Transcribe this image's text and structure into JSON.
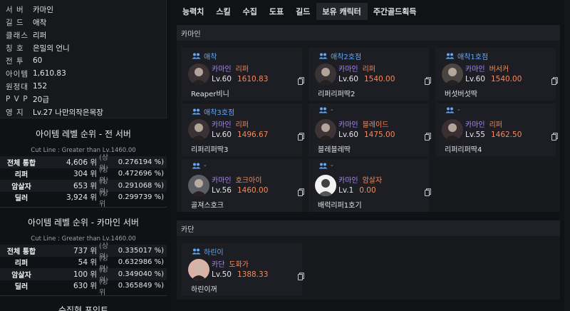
{
  "profile": {
    "rows": [
      {
        "key": "서 버",
        "value": "카마인"
      },
      {
        "key": "길 드",
        "value": "애착"
      },
      {
        "key": "클래스",
        "value": "리퍼"
      },
      {
        "key": "칭 호",
        "value": "은밀의 언니"
      },
      {
        "key": "전 투",
        "value": "60"
      },
      {
        "key": "아이템",
        "value": "1,610.83"
      },
      {
        "key": "원정대",
        "value": "152"
      },
      {
        "key": "P V P",
        "value": "20급"
      },
      {
        "key": "영 지",
        "value": "Lv.27 나만의작은목장"
      }
    ]
  },
  "rank_all": {
    "title": "아이템 레벨 순위 - 전 서버",
    "cutline": "Cut Line : Greater than Lv.1460.00",
    "rows": [
      {
        "label": "전체 통합",
        "pos": "4,606 위",
        "top": "(상위",
        "pct": "0.276194 %)"
      },
      {
        "label": "리퍼",
        "pos": "304 위",
        "top": "(상위",
        "pct": "0.472696 %)"
      },
      {
        "label": "암살자",
        "pos": "653 위",
        "top": "(상위",
        "pct": "0.291068 %)"
      },
      {
        "label": "딜러",
        "pos": "3,924 위",
        "top": "(상위",
        "pct": "0.299739 %)"
      }
    ]
  },
  "rank_server": {
    "title": "아이템 레벨 순위 - 카마인 서버",
    "cutline": "Cut Line : Greater than Lv.1460.00",
    "rows": [
      {
        "label": "전체 통합",
        "pos": "737 위",
        "top": "(상위",
        "pct": "0.335017 %)"
      },
      {
        "label": "리퍼",
        "pos": "54 위",
        "top": "(상위",
        "pct": "0.632986 %)"
      },
      {
        "label": "암살자",
        "pos": "100 위",
        "top": "(상위",
        "pct": "0.349040 %)"
      },
      {
        "label": "딜러",
        "pos": "630 위",
        "top": "(상위",
        "pct": "0.365849 %)"
      }
    ]
  },
  "next_section": "수집형 포인트",
  "tabs": [
    "능력치",
    "스킬",
    "수집",
    "도표",
    "길드",
    "보유 캐릭터",
    "주간골드획득"
  ],
  "active_tab": "보유 캐릭터",
  "groups": [
    {
      "server": "카마인",
      "cards": [
        {
          "guild": "애착",
          "server": "카마인",
          "class": "리퍼",
          "lv": "Lv.60",
          "ilvl": "1610.83",
          "name": "Reaper비니"
        },
        {
          "guild": "애착2호점",
          "server": "카마인",
          "class": "리퍼",
          "lv": "Lv.60",
          "ilvl": "1540.00",
          "name": "리퍼리퍼딱2"
        },
        {
          "guild": "애착1호점",
          "server": "카마인",
          "class": "버서커",
          "lv": "Lv.60",
          "ilvl": "1540.00",
          "name": "버섯버섯딱"
        },
        {
          "guild": "애착3호점",
          "server": "카마인",
          "class": "리퍼",
          "lv": "Lv.60",
          "ilvl": "1496.67",
          "name": "리퍼리퍼딱3"
        },
        {
          "guild": "-",
          "server": "카마인",
          "class": "블레이드",
          "lv": "Lv.60",
          "ilvl": "1475.00",
          "name": "블레블레딱"
        },
        {
          "guild": "-",
          "server": "카마인",
          "class": "리퍼",
          "lv": "Lv.55",
          "ilvl": "1462.50",
          "name": "리퍼리퍼딱4"
        },
        {
          "guild": "-",
          "server": "카마인",
          "class": "호크아이",
          "lv": "Lv.56",
          "ilvl": "1460.00",
          "name": "골져스호크"
        },
        {
          "guild": "-",
          "server": "카마인",
          "class": "암살자",
          "lv": "Lv.1",
          "ilvl": "0.00",
          "name": "배럭리퍼1호기"
        }
      ]
    },
    {
      "server": "카단",
      "cards": [
        {
          "guild": "하린이",
          "server": "카단",
          "class": "도화가",
          "lv": "Lv.50",
          "ilvl": "1388.33",
          "name": "하린이꺼"
        }
      ]
    }
  ],
  "colors": {
    "guild": "#5ea8ff",
    "server": "#a987f5",
    "accent": "#f58a5c"
  }
}
